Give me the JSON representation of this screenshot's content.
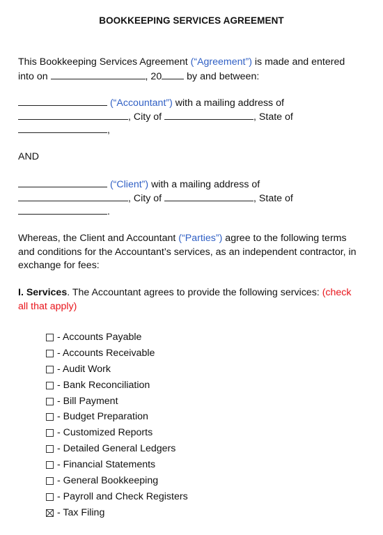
{
  "document": {
    "title": "BOOKKEEPING SERVICES AGREEMENT",
    "intro": {
      "part1": "This Bookkeeping Services Agreement ",
      "term": "(“Agreement”)",
      "part2": " is made and entered",
      "line2_prefix": "into on ",
      "line2_mid": ", 20",
      "line2_suffix": " by and between:"
    },
    "accountant": {
      "term": "(“Accountant”)",
      "text1": " with a mailing address of",
      "city": ", City of ",
      "state": ", State of",
      "end": ","
    },
    "and_label": "AND",
    "client": {
      "term": "(“Client”)",
      "text1": " with a mailing address of",
      "city": ", City of ",
      "state": ", State of",
      "end": "."
    },
    "whereas": {
      "part1": "Whereas, the Client and Accountant ",
      "term": "(“Parties”)",
      "part2": " agree to the following terms",
      "line2": "and conditions for the Accountant’s services, as an independent contractor, in",
      "line3": "exchange for fees:"
    },
    "services": {
      "heading": "I. Services",
      "text": ". The Accountant agrees to provide the following services: ",
      "note_line1": "(check",
      "note_line2": "all that apply)",
      "items": [
        {
          "label": "- Accounts Payable",
          "checked": false
        },
        {
          "label": "- Accounts Receivable",
          "checked": false
        },
        {
          "label": "- Audit Work",
          "checked": false
        },
        {
          "label": "- Bank Reconciliation",
          "checked": false
        },
        {
          "label": "- Bill Payment",
          "checked": false
        },
        {
          "label": "- Budget Preparation",
          "checked": false
        },
        {
          "label": "- Customized Reports",
          "checked": false
        },
        {
          "label": "- Detailed General Ledgers",
          "checked": false
        },
        {
          "label": "- Financial Statements",
          "checked": false
        },
        {
          "label": "- General Bookkeeping",
          "checked": false
        },
        {
          "label": "- Payroll and Check Registers",
          "checked": false
        },
        {
          "label": "- Tax Filing",
          "checked": true
        }
      ]
    }
  },
  "colors": {
    "term_blue": "#2f5fc4",
    "note_red": "#e8141b",
    "text": "#111111"
  }
}
